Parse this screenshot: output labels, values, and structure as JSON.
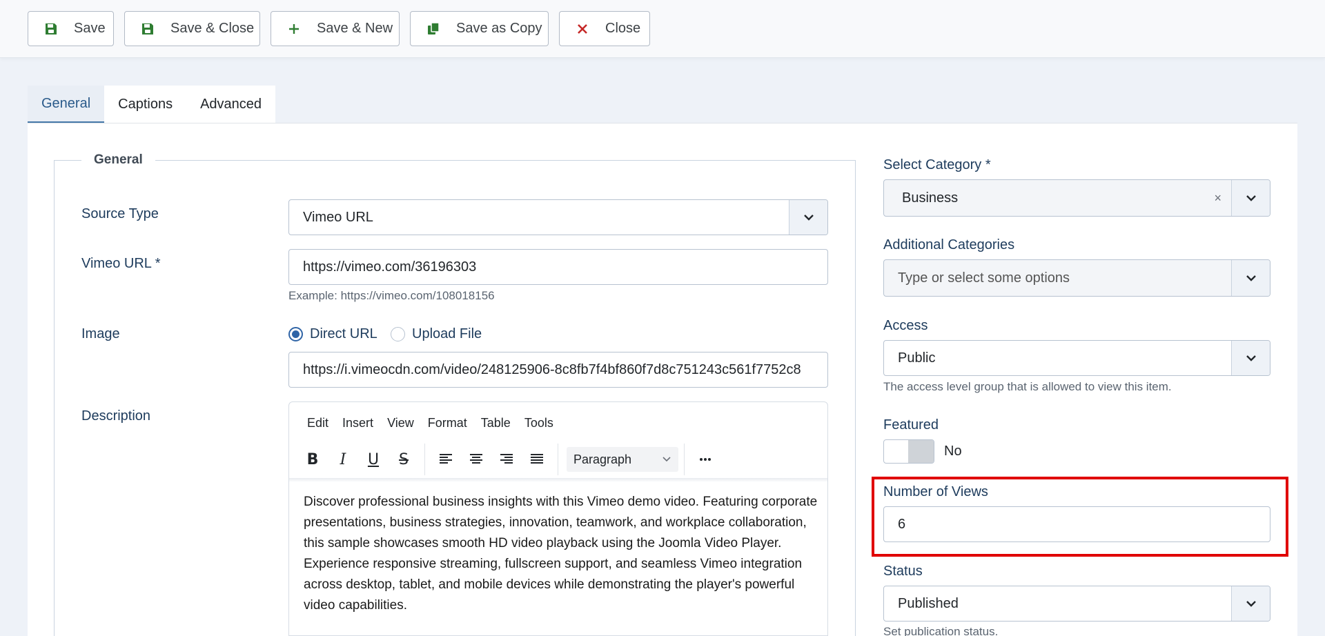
{
  "toolbar": {
    "save": "Save",
    "save_close": "Save & Close",
    "save_new": "Save & New",
    "save_copy": "Save as Copy",
    "close": "Close"
  },
  "tabs": [
    {
      "label": "General",
      "active": true
    },
    {
      "label": "Captions",
      "active": false
    },
    {
      "label": "Advanced",
      "active": false
    }
  ],
  "general": {
    "legend": "General",
    "source_type": {
      "label": "Source Type",
      "value": "Vimeo URL"
    },
    "vimeo_url": {
      "label": "Vimeo URL *",
      "value": "https://vimeo.com/36196303",
      "help": "Example: https://vimeo.com/108018156"
    },
    "image": {
      "label": "Image",
      "options": [
        "Direct URL",
        "Upload File"
      ],
      "selected": "Direct URL",
      "value": "https://i.vimeocdn.com/video/248125906-8c8fb7f4bf860f7d8c751243c561f7752c8"
    },
    "description": {
      "label": "Description",
      "menu": [
        "Edit",
        "Insert",
        "View",
        "Format",
        "Table",
        "Tools"
      ],
      "block_format": "Paragraph",
      "text": "Discover professional business insights with this Vimeo demo video. Featuring corporate presentations, business strategies, innovation, teamwork, and workplace collaboration, this sample showcases smooth HD video playback using the Joomla Video Player. Experience responsive streaming, fullscreen support, and seamless Vimeo integration across desktop, tablet, and mobile devices while demonstrating the player's powerful video capabilities."
    }
  },
  "sidebar": {
    "category": {
      "label": "Select Category *",
      "value": "Business",
      "clear": "×"
    },
    "additional": {
      "label": "Additional Categories",
      "placeholder": "Type or select some options"
    },
    "access": {
      "label": "Access",
      "value": "Public",
      "help": "The access level group that is allowed to view this item."
    },
    "featured": {
      "label": "Featured",
      "value": "No"
    },
    "views": {
      "label": "Number of Views",
      "value": "6"
    },
    "status": {
      "label": "Status",
      "value": "Published",
      "help": "Set publication status."
    }
  },
  "colors": {
    "accent": "#2f64a6",
    "highlight": "#e00000",
    "save_green": "#2f7d32",
    "close_red": "#c52827"
  }
}
